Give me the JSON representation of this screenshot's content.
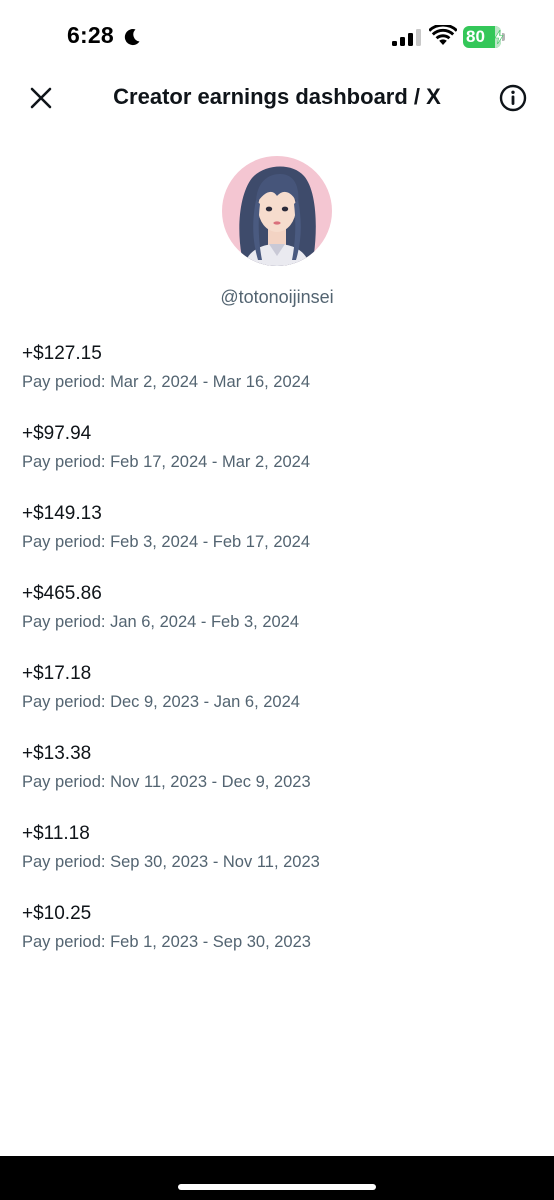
{
  "status_bar": {
    "time": "6:28",
    "battery_level": "80",
    "icons": [
      "moon-icon",
      "signal-icon",
      "wifi-icon",
      "battery-icon",
      "bolt-icon"
    ],
    "battery_color": "#34c759"
  },
  "header": {
    "title": "Creator earnings dashboard / X",
    "close_icon": "close-icon",
    "info_icon": "info-icon"
  },
  "profile": {
    "handle": "@totonoijinsei"
  },
  "earnings": [
    {
      "amount": "+$127.15",
      "period_prefix": "Pay period: ",
      "period_range": "Mar 2, 2024 - Mar 16, 2024"
    },
    {
      "amount": "+$97.94",
      "period_prefix": "Pay period: ",
      "period_range": "Feb 17, 2024 - Mar 2, 2024"
    },
    {
      "amount": "+$149.13",
      "period_prefix": "Pay period: ",
      "period_range": "Feb 3, 2024 - Feb 17, 2024"
    },
    {
      "amount": "+$465.86",
      "period_prefix": "Pay period: ",
      "period_range": "Jan 6, 2024 - Feb 3, 2024"
    },
    {
      "amount": "+$17.18",
      "period_prefix": "Pay period: ",
      "period_range": "Dec 9, 2023 - Jan 6, 2024"
    },
    {
      "amount": "+$13.38",
      "period_prefix": "Pay period: ",
      "period_range": "Nov 11, 2023 - Dec 9, 2023"
    },
    {
      "amount": "+$11.18",
      "period_prefix": "Pay period: ",
      "period_range": "Sep 30, 2023 - Nov 11, 2023"
    },
    {
      "amount": "+$10.25",
      "period_prefix": "Pay period: ",
      "period_range": "Feb 1, 2023 - Sep 30, 2023"
    }
  ],
  "colors": {
    "text_primary": "#0f1419",
    "text_secondary": "#536471",
    "background": "#ffffff"
  }
}
